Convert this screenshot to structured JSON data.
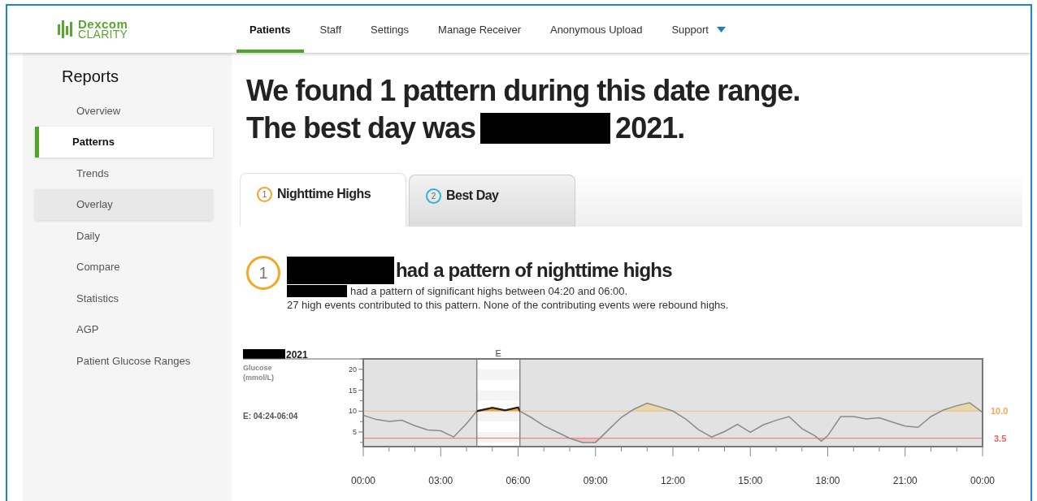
{
  "logo": {
    "brand": "Dexcom",
    "product": "CLARITY"
  },
  "nav": [
    {
      "label": "Patients",
      "selected": true,
      "dropdown": false
    },
    {
      "label": "Staff",
      "selected": false,
      "dropdown": false
    },
    {
      "label": "Settings",
      "selected": false,
      "dropdown": false
    },
    {
      "label": "Manage Receiver",
      "selected": false,
      "dropdown": false
    },
    {
      "label": "Anonymous Upload",
      "selected": false,
      "dropdown": false
    },
    {
      "label": "Support",
      "selected": false,
      "dropdown": true
    }
  ],
  "sidebar": {
    "title": "Reports",
    "items": [
      {
        "label": "Overview",
        "selected": false,
        "hovered": false
      },
      {
        "label": "Patterns",
        "selected": true,
        "hovered": false
      },
      {
        "label": "Trends",
        "selected": false,
        "hovered": false
      },
      {
        "label": "Overlay",
        "selected": false,
        "hovered": true
      },
      {
        "label": "Daily",
        "selected": false,
        "hovered": false
      },
      {
        "label": "Compare",
        "selected": false,
        "hovered": false
      },
      {
        "label": "Statistics",
        "selected": false,
        "hovered": false
      },
      {
        "label": "AGP",
        "selected": false,
        "hovered": false
      },
      {
        "label": "Patient Glucose Ranges",
        "selected": false,
        "hovered": false
      }
    ]
  },
  "headline": [
    [
      {
        "kind": "text",
        "text": "We found 1 pattern during this date range."
      }
    ],
    [
      {
        "kind": "text",
        "text": "The best day was"
      },
      {
        "kind": "redaction"
      },
      {
        "kind": "text",
        "text": "2021."
      }
    ]
  ],
  "pattern_tabs": [
    {
      "number": "1",
      "label": "Nighttime Highs",
      "color": "#f5a623",
      "selected": true
    },
    {
      "number": "2",
      "label": "Best Day",
      "color": "#2bb5d8",
      "selected": false
    }
  ],
  "pattern": {
    "number": "1",
    "color": "#f5a623",
    "title": [
      {
        "kind": "redaction"
      },
      {
        "kind": "text",
        "text": "had a pattern of nighttime highs"
      }
    ],
    "description": [
      [
        {
          "kind": "redaction"
        },
        {
          "kind": "text",
          "text": "had a pattern of significant highs between 04:20 and 06:00."
        }
      ],
      [
        {
          "kind": "text",
          "text": "27 high events contributed to this pattern. None of the contributing events were rebound highs."
        }
      ]
    ]
  },
  "chart": {
    "date": [
      {
        "kind": "redaction"
      },
      {
        "kind": "text",
        "text": "2021"
      }
    ],
    "axis_title": "Glucose (mmol/L)",
    "event_label": "E: 04:24-06:04",
    "chart_data": {
      "type": "line",
      "x": [
        0,
        0.5,
        1,
        1.5,
        2,
        2.5,
        3,
        3.5,
        4,
        4.4,
        5,
        5.5,
        6,
        6.07,
        6.5,
        7,
        7.5,
        8,
        8.5,
        9,
        9.5,
        10,
        10.5,
        11,
        11.5,
        12,
        12.5,
        13,
        13.5,
        14,
        14.5,
        15,
        15.5,
        16,
        16.5,
        17,
        17.5,
        17.75,
        18,
        18.5,
        19,
        19.5,
        20,
        20.5,
        21,
        21.5,
        22,
        22.5,
        23,
        23.5,
        24
      ],
      "series": [
        {
          "color": "#8a8a8a",
          "values": [
            9,
            8,
            7.5,
            7.8,
            6.5,
            5.5,
            5.3,
            3.8,
            7,
            10,
            10.8,
            10.2,
            10.9,
            10,
            8.5,
            6.5,
            5,
            3.5,
            2.5,
            2.5,
            5.5,
            8.5,
            10.5,
            11.9,
            11,
            10,
            8.1,
            5.5,
            3.8,
            5.1,
            6.8,
            4.9,
            6.7,
            7.8,
            8.7,
            5.8,
            4.1,
            2.8,
            4.1,
            8.7,
            8.7,
            8.1,
            8.4,
            7.4,
            6.4,
            6.1,
            8.7,
            10.3,
            11.3,
            12,
            9.7
          ]
        }
      ],
      "xlim": [
        0,
        24
      ],
      "ylim": [
        1.5,
        22.5
      ],
      "xticks": [
        {
          "value": 0,
          "label": "00:00"
        },
        {
          "value": 3,
          "label": "03:00"
        },
        {
          "value": 6,
          "label": "06:00"
        },
        {
          "value": 9,
          "label": "09:00"
        },
        {
          "value": 12,
          "label": "12:00"
        },
        {
          "value": 15,
          "label": "15:00"
        },
        {
          "value": 18,
          "label": "18:00"
        },
        {
          "value": 21,
          "label": "21:00"
        },
        {
          "value": 24,
          "label": "00:00"
        }
      ],
      "yticks": [
        5,
        10,
        15,
        20
      ],
      "ref_lines": [
        {
          "axis": "y",
          "value": 10,
          "label": "10.0",
          "color": "#f7a55a"
        },
        {
          "axis": "y",
          "value": 3.5,
          "label": "3.5",
          "color": "#f06060"
        }
      ],
      "bands": [
        {
          "axis": "x",
          "from": 4.4,
          "to": 6.07,
          "label": "E"
        }
      ]
    }
  }
}
